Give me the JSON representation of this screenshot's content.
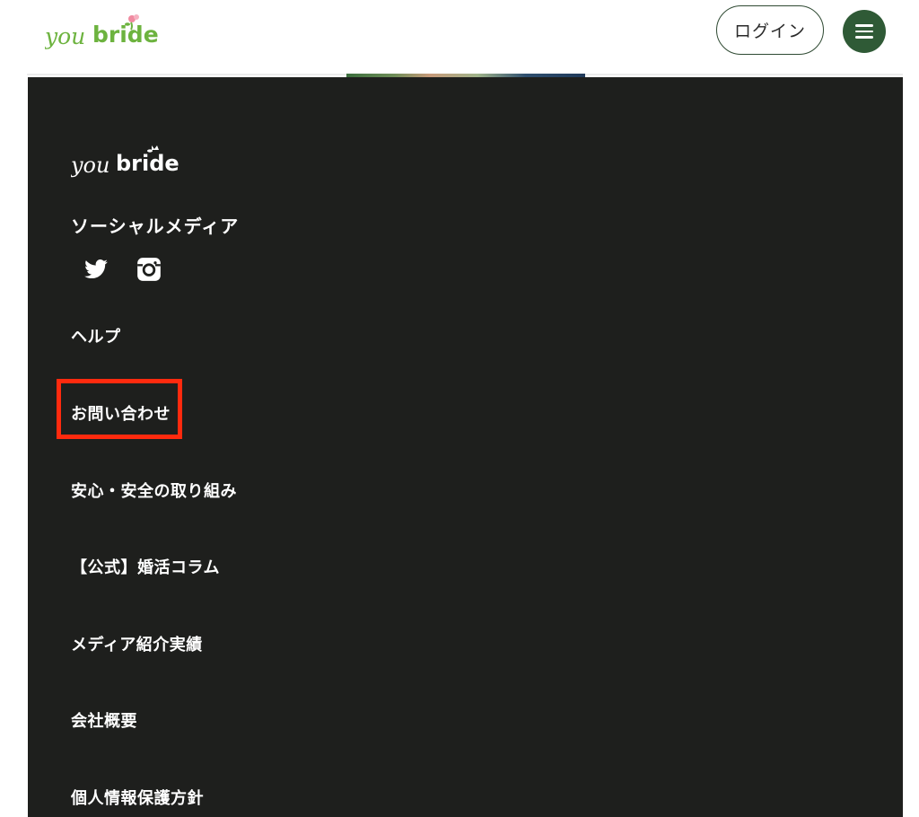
{
  "header": {
    "logo": {
      "you": "you",
      "bride": "bride"
    },
    "login_label": "ログイン",
    "menu_icon": "hamburger-menu-icon"
  },
  "footer": {
    "logo": {
      "you": "you",
      "bride": "bride"
    },
    "social_heading": "ソーシャルメディア",
    "social_icons": [
      "twitter-icon",
      "instagram-icon"
    ],
    "links": [
      "ヘルプ",
      "お問い合わせ",
      "安心・安全の取り組み",
      "【公式】婚活コラム",
      "メディア紹介実績",
      "会社概要",
      "個人情報保護方針"
    ]
  },
  "colors": {
    "brand_green": "#2f5a36",
    "logo_green": "#6db33f",
    "footer_bg": "#1e1f1d",
    "highlight_red": "#ff2a0e"
  }
}
